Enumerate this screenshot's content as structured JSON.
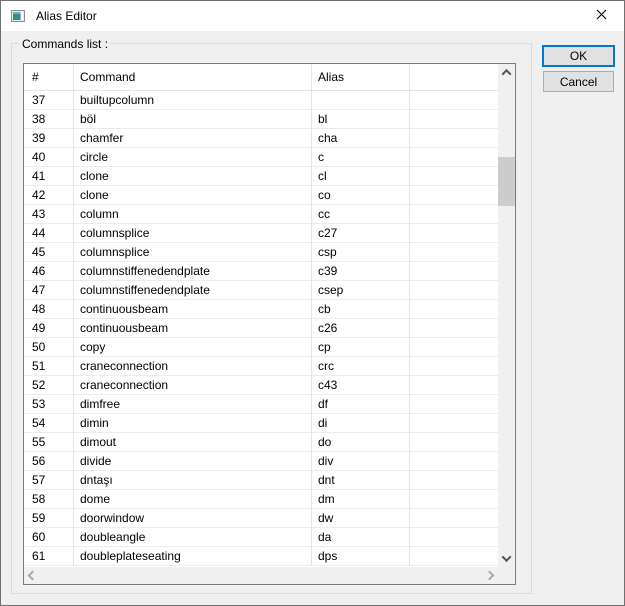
{
  "window": {
    "title": "Alias Editor"
  },
  "group_label": "Commands list :",
  "buttons": {
    "ok": "OK",
    "cancel": "Cancel"
  },
  "table": {
    "headers": [
      "#",
      "Command",
      "Alias",
      ""
    ],
    "rows": [
      [
        "37",
        "builtupcolumn",
        ""
      ],
      [
        "38",
        "böl",
        "bl"
      ],
      [
        "39",
        "chamfer",
        "cha"
      ],
      [
        "40",
        "circle",
        "c"
      ],
      [
        "41",
        "clone",
        "cl"
      ],
      [
        "42",
        "clone",
        "co"
      ],
      [
        "43",
        "column",
        "cc"
      ],
      [
        "44",
        "columnsplice",
        "c27"
      ],
      [
        "45",
        "columnsplice",
        "csp"
      ],
      [
        "46",
        "columnstiffenedendplate",
        "c39"
      ],
      [
        "47",
        "columnstiffenedendplate",
        "csep"
      ],
      [
        "48",
        "continuousbeam",
        "cb"
      ],
      [
        "49",
        "continuousbeam",
        "c26"
      ],
      [
        "50",
        "copy",
        "cp"
      ],
      [
        "51",
        "craneconnection",
        "crc"
      ],
      [
        "52",
        "craneconnection",
        "c43"
      ],
      [
        "53",
        "dimfree",
        "df"
      ],
      [
        "54",
        "dimin",
        "di"
      ],
      [
        "55",
        "dimout",
        "do"
      ],
      [
        "56",
        "divide",
        "div"
      ],
      [
        "57",
        "dntaşı",
        "dnt"
      ],
      [
        "58",
        "dome",
        "dm"
      ],
      [
        "59",
        "doorwindow",
        "dw"
      ],
      [
        "60",
        "doubleangle",
        "da"
      ],
      [
        "61",
        "doubleplateseating",
        "dps"
      ]
    ],
    "first_visible_row": "37",
    "last_visible_row": "61"
  },
  "icons": {
    "app": "form-window-icon",
    "close": "close-icon",
    "scroll_up": "chevron-up",
    "scroll_down": "chevron-down",
    "scroll_left": "chevron-left",
    "scroll_right": "chevron-right"
  },
  "colors": {
    "accent": "#0078d7",
    "titlebar_bg": "#ffffff",
    "dialog_bg": "#f0f0f0",
    "button_face": "#e1e1e1",
    "scroll_thumb": "#cdcdcd",
    "list_border": "#7a7a7a"
  }
}
